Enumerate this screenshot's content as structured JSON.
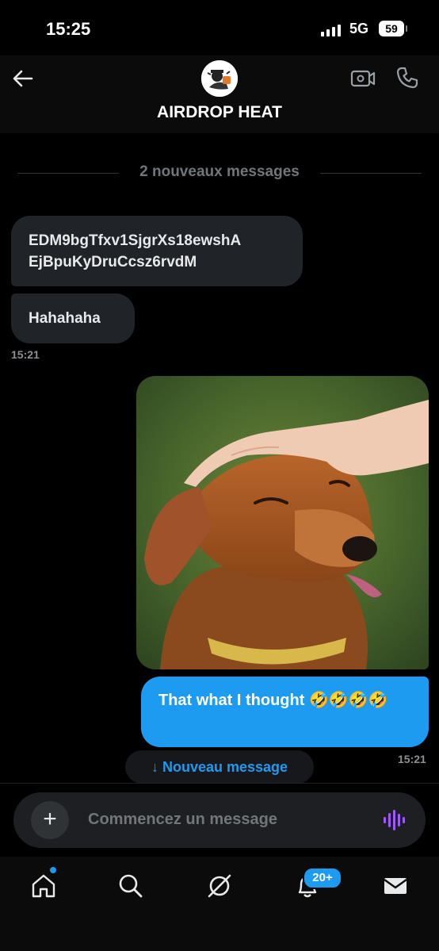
{
  "status_bar": {
    "time": "15:25",
    "network": "5G",
    "battery": "59"
  },
  "header": {
    "title": "AIRDROP HEAT"
  },
  "divider": {
    "label": "2 nouveaux messages"
  },
  "messages": [
    {
      "from": "them",
      "text": "EDM9bgTfxv1SjgrXs18ewshA\nEjBpuKyDruCcsz6rvdM"
    },
    {
      "from": "them",
      "text": "Hahahaha",
      "time": "15:21"
    },
    {
      "from": "me",
      "type": "image",
      "description": "dachshund-being-patted"
    },
    {
      "from": "me",
      "text": "That what I thought 🤣🤣🤣🤣",
      "time": "15:21"
    }
  ],
  "new_message_button": {
    "label": "↓ Nouveau message"
  },
  "composer": {
    "placeholder": "Commencez un message"
  },
  "tabbar": {
    "items": [
      "home-icon",
      "search-icon",
      "grok-icon",
      "notifications-icon",
      "messages-icon"
    ],
    "notifications_badge": "20+"
  },
  "colors": {
    "accent": "#1d9bf0",
    "bubble_in": "#202327",
    "background": "#000000"
  }
}
